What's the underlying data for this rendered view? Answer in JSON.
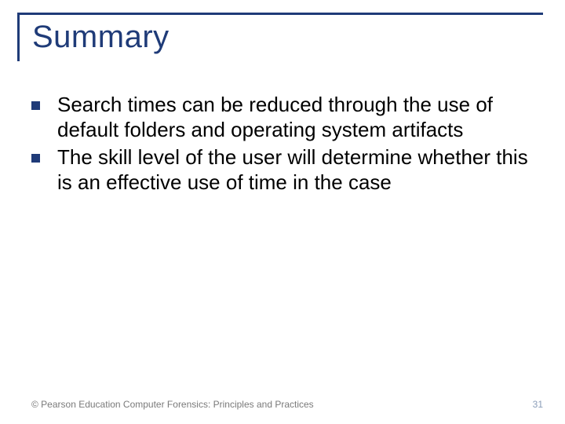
{
  "title": "Summary",
  "bullets": [
    "Search times can be reduced through the use of default folders and operating system artifacts",
    "The skill level of the user will determine whether this is an effective use of time in the case"
  ],
  "footer": {
    "left": "© Pearson Education  Computer Forensics: Principles and Practices",
    "right": "31"
  }
}
